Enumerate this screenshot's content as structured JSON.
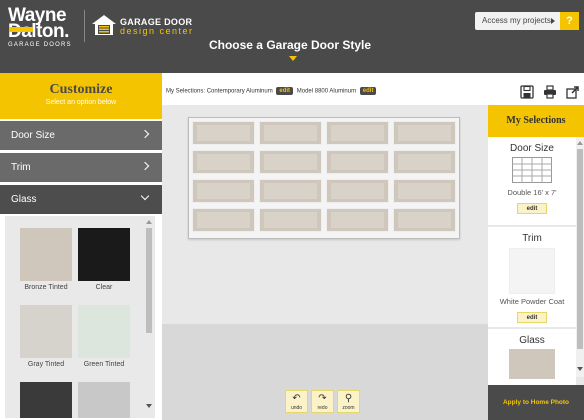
{
  "header": {
    "brand_line1": "Wayne",
    "brand_line2": "Dalton.",
    "brand_tagline": "GARAGE DOORS",
    "design_center_line1": "GARAGE DOOR",
    "design_center_line2": "design center",
    "title": "Choose a Garage Door Style",
    "access_projects": "Access my projects",
    "help": "?"
  },
  "customize": {
    "title": "Customize",
    "subtitle": "Select an option below",
    "options": [
      {
        "label": "Door Size",
        "state": "collapsed"
      },
      {
        "label": "Trim",
        "state": "collapsed"
      },
      {
        "label": "Glass",
        "state": "expanded"
      }
    ],
    "glass_swatches": [
      {
        "label": "Bronze Tinted",
        "color": "#cfc7bb"
      },
      {
        "label": "Clear",
        "color": "#1a1a1a"
      },
      {
        "label": "Gray Tinted",
        "color": "#d6d3cc"
      },
      {
        "label": "Green Tinted",
        "color": "#dde6dc"
      },
      {
        "label": "",
        "color": "#3a3a3a"
      },
      {
        "label": "",
        "color": "#c8c8c8"
      }
    ]
  },
  "selections_bar": {
    "prefix": "My Selections:",
    "item1": "Contemporary Aluminum",
    "item2": "Model 8800 Aluminum",
    "edit": "edit"
  },
  "controls": {
    "undo": "undo",
    "redo": "redo",
    "zoom": "zoom"
  },
  "my_selections": {
    "title": "My Selections",
    "cards": [
      {
        "title": "Door Size",
        "value": "Double 16' x 7'",
        "edit": "edit"
      },
      {
        "title": "Trim",
        "value": "White Powder Coat",
        "edit": "edit"
      },
      {
        "title": "Glass",
        "value": ""
      }
    ],
    "apply": "Apply to Home Photo"
  },
  "colors": {
    "accent": "#f5c400",
    "header_bg": "#4a4a4a",
    "menu_bg": "#6a6a6a",
    "glass_bronze": "#cfc7bb"
  }
}
